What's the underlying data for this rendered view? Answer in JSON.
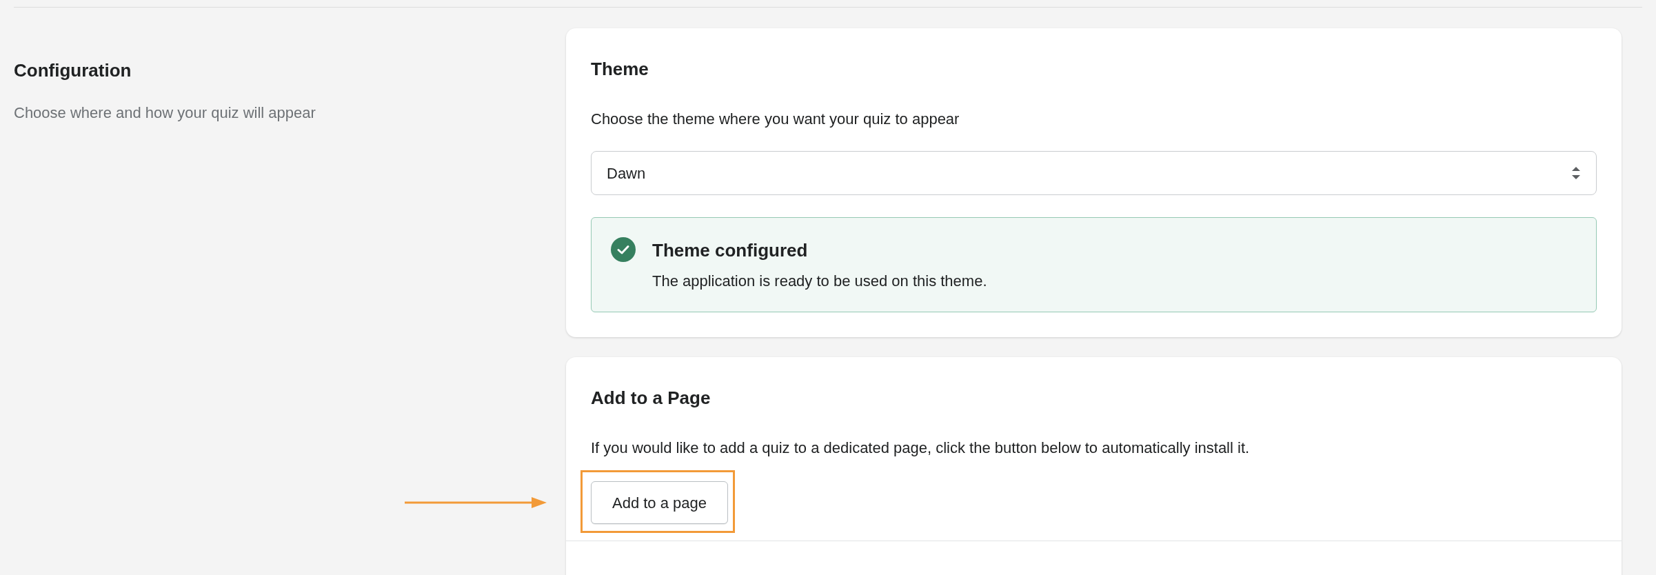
{
  "section": {
    "title": "Configuration",
    "description": "Choose where and how your quiz will appear"
  },
  "theme_card": {
    "title": "Theme",
    "description": "Choose the theme where you want your quiz to appear",
    "select": {
      "value": "Dawn"
    },
    "banner": {
      "kind": "success",
      "title": "Theme configured",
      "message": "The application is ready to be used on this theme."
    }
  },
  "page_card": {
    "title": "Add to a Page",
    "description": "If you would like to add a quiz to a dedicated page, click the button below to automatically install it.",
    "button": "Add to a page",
    "highlighted": true
  }
}
